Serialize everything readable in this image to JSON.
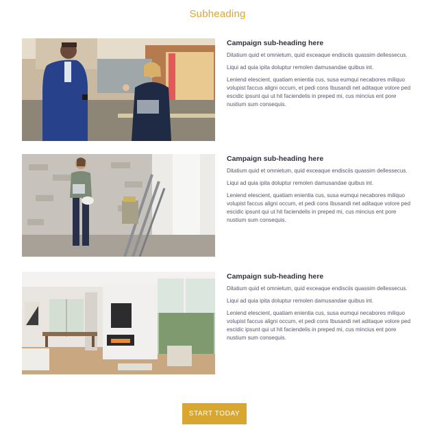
{
  "subheading": "Subheading",
  "items": [
    {
      "heading": "Campaign sub-heading here",
      "p1": "Ditatium quid et omnietum, quid exceaque endisciis quassim dellessecus.",
      "p2": "Liqui ad quia ipita doluptur remolen damusandae quibus int.",
      "p3": "Leniend elescient, quatiam enientia cus, susa eumqui necabores miliquo volupist faccus aligni occum, et pedi cons Ibusandi net aditaque volore ped escidic ipsunt qui ut hit faciendelis in preped mi, cus mincius ent pore nustium sum consequis."
    },
    {
      "heading": "Campaign sub-heading here",
      "p1": "Ditatium quid et omnietum, quid exceaque endisciis quassim dellessecus.",
      "p2": "Liqui ad quia ipita doluptur remolen damusandae quibus int.",
      "p3": "Leniend elescient, quatiam enientia cus, susa eumqui necabores miliquo volupist faccus aligni occum, et pedi cons Ibusandi net aditaque volore ped escidic ipsunt qui ut hit faciendelis in preped mi, cus mincius ent pore nustium sum consequis."
    },
    {
      "heading": "Campaign sub-heading here",
      "p1": "Ditatium quid et omnietum, quid exceaque endisciis quassim dellessecus.",
      "p2": "Liqui ad quia ipita doluptur remolen damusandae quibus int.",
      "p3": "Leniend elescient, quatiam enientia cus, susa eumqui necabores miliquo volupist faccus aligni occum, et pedi cons Ibusandi net aditaque volore ped escidic ipsunt qui ut hit faciendelis in preped mi, cus mincius ent pore nustium sum consequis."
    }
  ],
  "cta": {
    "label": "START TODAY"
  },
  "colors": {
    "accent": "#d9a72f",
    "heading": "#2f2f3d",
    "body": "#55556a"
  }
}
